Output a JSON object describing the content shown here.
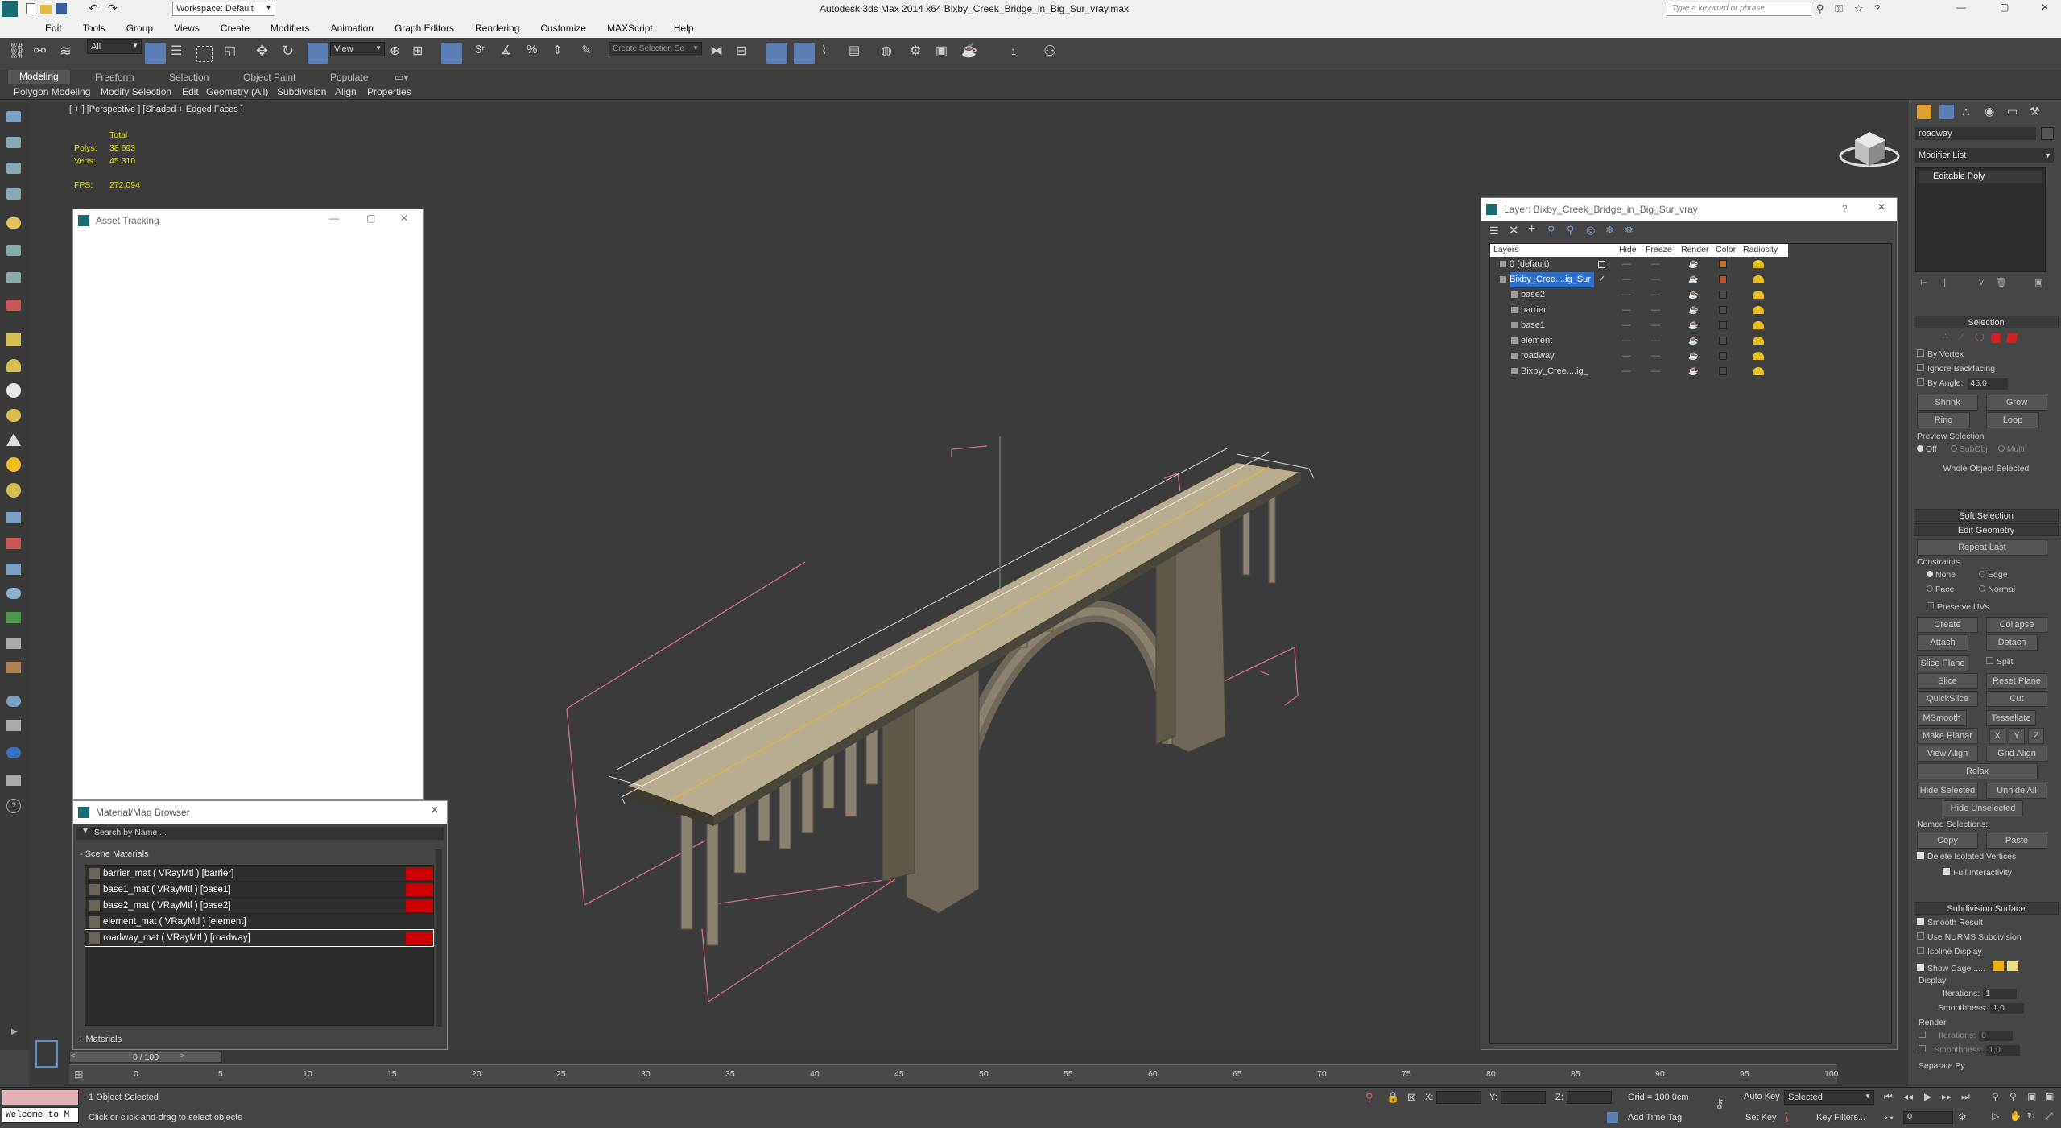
{
  "app": {
    "title": "Autodesk 3ds Max  2014 x64    Bixby_Creek_Bridge_in_Big_Sur_vray.max",
    "search_placeholder": "Type a keyword or phrase",
    "workspace": "Workspace: Default"
  },
  "menu": [
    "Edit",
    "Tools",
    "Group",
    "Views",
    "Create",
    "Modifiers",
    "Animation",
    "Graph Editors",
    "Rendering",
    "Customize",
    "MAXScript",
    "Help"
  ],
  "toolbar": {
    "selection_filter": "All",
    "ref_coord": "View",
    "named_sel": "Create Selection Se",
    "count": "1"
  },
  "ribbon": {
    "tabs": [
      "Modeling",
      "Freeform",
      "Selection",
      "Object Paint",
      "Populate"
    ],
    "subtabs": [
      "Polygon Modeling",
      "Modify Selection",
      "Edit",
      "Geometry (All)",
      "Subdivision",
      "Align",
      "Properties"
    ]
  },
  "viewport": {
    "label": "[ + ] [Perspective ] [Shaded + Edged Faces ]",
    "stats": {
      "total": "Total",
      "polys_label": "Polys:",
      "polys": "38 693",
      "verts_label": "Verts:",
      "verts": "45 310",
      "fps_label": "FPS:",
      "fps": "272,094"
    }
  },
  "asset_tracking": {
    "title": "Asset Tracking"
  },
  "material_browser": {
    "title": "Material/Map Browser",
    "search_placeholder": "Search by Name ...",
    "section": "- Scene Materials",
    "materials": [
      {
        "name": "barrier_mat  ( VRayMtl ) [barrier]",
        "red": true
      },
      {
        "name": "base1_mat  ( VRayMtl ) [base1]",
        "red": true
      },
      {
        "name": "base2_mat  ( VRayMtl ) [base2]",
        "red": true
      },
      {
        "name": "element_mat  ( VRayMtl ) [element]",
        "red": false
      },
      {
        "name": "roadway_mat  ( VRayMtl ) [roadway]",
        "red": true
      }
    ],
    "footer": "+ Materials"
  },
  "layer_window": {
    "title": "Layer: Bixby_Creek_Bridge_in_Big_Sur_vray",
    "help": "?",
    "columns": [
      "Layers",
      "Hide",
      "Freeze",
      "Render",
      "Color",
      "Radiosity"
    ],
    "layers": [
      {
        "name": "0 (default)",
        "indent": 1,
        "selected": false,
        "color": "#c07030"
      },
      {
        "name": "Bixby_Cree....ig_Sur",
        "indent": 1,
        "selected": true,
        "color": "#c05020"
      },
      {
        "name": "base2",
        "indent": 2,
        "selected": false,
        "color": "#4a4a4a"
      },
      {
        "name": "barrier",
        "indent": 2,
        "selected": false,
        "color": "#4a4a4a"
      },
      {
        "name": "base1",
        "indent": 2,
        "selected": false,
        "color": "#4a4a4a"
      },
      {
        "name": "element",
        "indent": 2,
        "selected": false,
        "color": "#4a4a4a"
      },
      {
        "name": "roadway",
        "indent": 2,
        "selected": false,
        "color": "#4a4a4a"
      },
      {
        "name": "Bixby_Cree....ig_",
        "indent": 2,
        "selected": false,
        "color": "#4a4a4a"
      }
    ]
  },
  "command_panel": {
    "object_name": "roadway",
    "modifier_list": "Modifier List",
    "stack_item": "Editable Poly",
    "selection": {
      "title": "Selection",
      "by_vertex": "By Vertex",
      "ignore_backfacing": "Ignore Backfacing",
      "by_angle": "By Angle:",
      "angle": "45,0",
      "shrink": "Shrink",
      "grow": "Grow",
      "ring": "Ring",
      "loop": "Loop",
      "preview": "Preview Selection",
      "off": "Off",
      "subobj": "SubObj",
      "multi": "Multi",
      "whole": "Whole Object Selected"
    },
    "soft_selection": "Soft Selection",
    "edit_geometry": {
      "title": "Edit Geometry",
      "repeat_last": "Repeat Last",
      "constraints": "Constraints",
      "none": "None",
      "edge": "Edge",
      "face": "Face",
      "normal": "Normal",
      "preserve_uvs": "Preserve UVs",
      "create": "Create",
      "collapse": "Collapse",
      "attach": "Attach",
      "detach": "Detach",
      "slice_plane": "Slice Plane",
      "split": "Split",
      "slice": "Slice",
      "reset_plane": "Reset Plane",
      "quickslice": "QuickSlice",
      "cut": "Cut",
      "msmooth": "MSmooth",
      "tessellate": "Tessellate",
      "make_planar": "Make Planar",
      "x": "X",
      "y": "Y",
      "z": "Z",
      "view_align": "View Align",
      "grid_align": "Grid Align",
      "relax": "Relax",
      "hide_selected": "Hide Selected",
      "unhide_all": "Unhide All",
      "hide_unselected": "Hide Unselected",
      "named_selections": "Named Selections:",
      "copy": "Copy",
      "paste": "Paste",
      "delete_isolated": "Delete Isolated Vertices",
      "full_interactivity": "Full Interactivity"
    },
    "subdivision": {
      "title": "Subdivision Surface",
      "smooth_result": "Smooth Result",
      "nurms": "Use NURMS Subdivision",
      "isoline": "Isoline Display",
      "show_cage": "Show Cage......",
      "display": "Display",
      "iterations": "Iterations:",
      "iter_val": "1",
      "smoothness": "Smoothness:",
      "smooth_val": "1,0",
      "render": "Render",
      "r_iterations": "Iterations:",
      "r_iter_val": "0",
      "r_smoothness": "Smoothness:",
      "r_smooth_val": "1,0",
      "separate_by": "Separate By"
    }
  },
  "timeline": {
    "slider": "0 / 100",
    "ticks": [
      "0",
      "5",
      "10",
      "15",
      "20",
      "25",
      "30",
      "35",
      "40",
      "45",
      "50",
      "55",
      "60",
      "65",
      "70",
      "75",
      "80",
      "85",
      "90",
      "95",
      "100"
    ]
  },
  "status": {
    "maxscript": "Welcome to M",
    "objects": "1 Object Selected",
    "prompt": "Click or click-and-drag to select objects",
    "x_label": "X:",
    "y_label": "Y:",
    "z_label": "Z:",
    "grid": "Grid = 100,0cm",
    "add_time_tag": "Add Time Tag",
    "auto_key": "Auto Key",
    "set_key": "Set Key",
    "selected": "Selected",
    "key_filters": "Key Filters...",
    "frame": "0"
  }
}
